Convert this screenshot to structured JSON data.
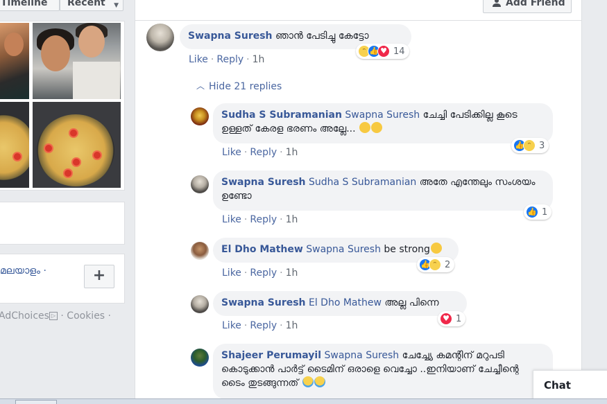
{
  "left": {
    "tabs": [
      {
        "label": "Timeline"
      },
      {
        "label": "Recent"
      }
    ],
    "language_text": "മലയാളം ·",
    "plus_label": "+",
    "footer": {
      "adchoices": "AdChoices",
      "cookies": "· Cookies ·"
    }
  },
  "header": {
    "add_friend": "Add Friend"
  },
  "comment": {
    "author": "Swapna Suresh",
    "text": "ഞാൻ പേടിച്ചു കേട്ടോ",
    "like": "Like",
    "reply": "Reply",
    "time": "1h",
    "reaction_count": "14"
  },
  "hide_replies": "Hide 21 replies",
  "replies": [
    {
      "author": "Sudha S Subramanian",
      "mention": "Swapna Suresh",
      "text": "ചേച്ചി പേടിക്കില്ല കൂടെ ഉള്ളത് കേരള ഭരണം അല്ലേ...",
      "like": "Like",
      "reply": "Reply",
      "time": "1h",
      "reaction_count": "3"
    },
    {
      "author": "Swapna Suresh",
      "mention": "Sudha S Subramanian",
      "text": "അതേ എന്തേലും സംശയം ഉണ്ടോ",
      "like": "Like",
      "reply": "Reply",
      "time": "1h",
      "reaction_count": "1"
    },
    {
      "author": "El Dho Mathew",
      "mention": "Swapna Suresh",
      "text": "be strong",
      "like": "Like",
      "reply": "Reply",
      "time": "1h",
      "reaction_count": "2"
    },
    {
      "author": "Swapna Suresh",
      "mention": "El Dho Mathew",
      "text": "അല്ല പിന്നെ",
      "like": "Like",
      "reply": "Reply",
      "time": "1h",
      "reaction_count": "1"
    },
    {
      "author": "Shajeer Perumayil",
      "mention": "Swapna Suresh",
      "text": "ചേച്ച്യേ കമന്റിന് മറുപടി കൊടുക്കാൻ പാർട്ട് ടൈമിന് ഒരാളെ വെച്ചോ ..ഇനിയാണ് ചേച്ചീന്റെ ടൈം തുടങ്ങുന്നത്"
    }
  ],
  "chat": {
    "label": "Chat"
  },
  "colors": {
    "link": "#385898",
    "like_blue": "#1877f2",
    "love_red": "#f0284a",
    "haha_yellow": "#f7d14e",
    "bubble": "#f2f3f5"
  }
}
